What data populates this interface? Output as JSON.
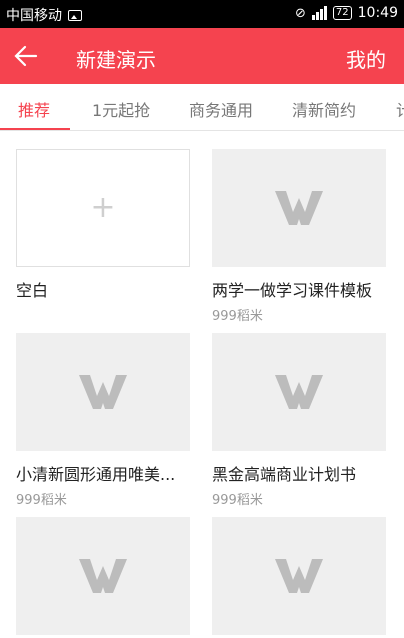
{
  "status": {
    "carrier": "中国移动",
    "battery": "72",
    "time": "10:49"
  },
  "appbar": {
    "title": "新建演示",
    "right_label": "我的"
  },
  "tabs": [
    "推荐",
    "1元起抢",
    "商务通用",
    "清新简约",
    "计"
  ],
  "cards": [
    {
      "title": "空白",
      "sub": ""
    },
    {
      "title": "两学一做学习课件模板",
      "sub": "999稻米"
    },
    {
      "title": "小清新圆形通用唯美...",
      "sub": "999稻米"
    },
    {
      "title": "黑金高端商业计划书",
      "sub": "999稻米"
    },
    {
      "title": "",
      "sub": ""
    },
    {
      "title": "",
      "sub": ""
    }
  ],
  "colors": {
    "accent": "#f5434f",
    "thumb_bg": "#efefef",
    "logo": "#bcbcbc"
  },
  "icons": {
    "back": "arrow-left-icon",
    "add": "plus-icon",
    "logo": "wps-logo-icon"
  }
}
